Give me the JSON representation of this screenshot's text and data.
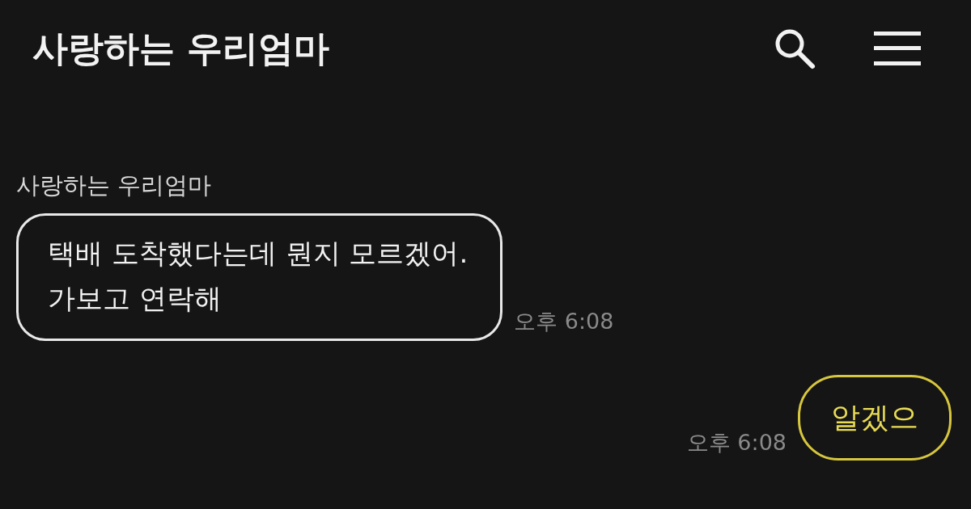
{
  "header": {
    "title": "사랑하는 우리엄마"
  },
  "messages": [
    {
      "kind": "received",
      "sender": "사랑하는 우리엄마",
      "lines": [
        "택배 도착했다는데 뭔지 모르겠어.",
        "가보고 연락해"
      ],
      "time": "오후 6:08"
    },
    {
      "kind": "sent",
      "lines": [
        "알겠으"
      ],
      "time": "오후 6:08"
    }
  ]
}
